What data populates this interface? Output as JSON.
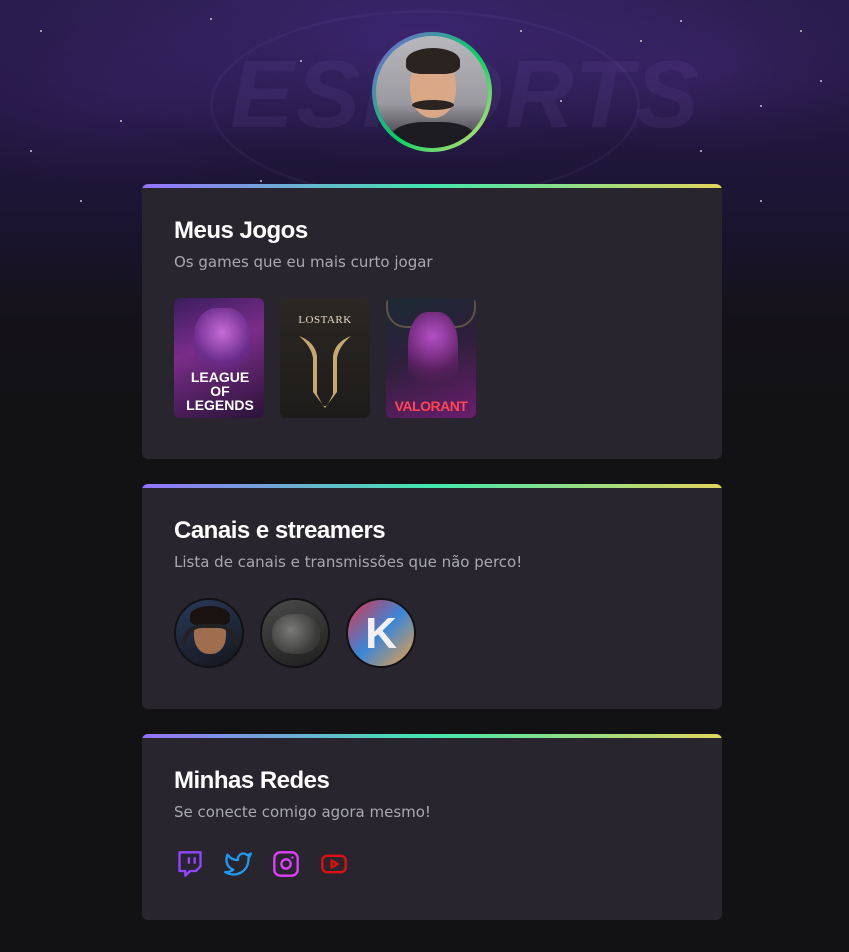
{
  "profile": {
    "avatar_label": "profile-avatar"
  },
  "background": {
    "text": "ESPORTS"
  },
  "games_card": {
    "title": "Meus Jogos",
    "subtitle": "Os games que eu mais curto jogar",
    "games": [
      {
        "name": "League of Legends",
        "logo_line1": "LEAGUE OF",
        "logo_line2": "LEGENDS"
      },
      {
        "name": "Lost Ark",
        "logo": "LOSTARK"
      },
      {
        "name": "Valorant",
        "logo": "VALORANT"
      }
    ]
  },
  "channels_card": {
    "title": "Canais e streamers",
    "subtitle": "Lista de canais e transmissões que não perco!",
    "channels": [
      {
        "letter": ""
      },
      {
        "letter": ""
      },
      {
        "letter": "K"
      }
    ]
  },
  "social_card": {
    "title": "Minhas Redes",
    "subtitle": "Se conecte comigo agora mesmo!",
    "links": [
      {
        "icon": "twitch-icon",
        "color": "#9146ff"
      },
      {
        "icon": "twitter-icon",
        "color": "#1d9bf0"
      },
      {
        "icon": "instagram-icon",
        "color": "#e040fb"
      },
      {
        "icon": "youtube-icon",
        "color": "#ff0000"
      }
    ]
  },
  "colors": {
    "background": "#121214",
    "card": "#29252f",
    "gradient_start": "#9572fc",
    "gradient_mid": "#43e7ad",
    "gradient_end": "#e2d45c"
  }
}
